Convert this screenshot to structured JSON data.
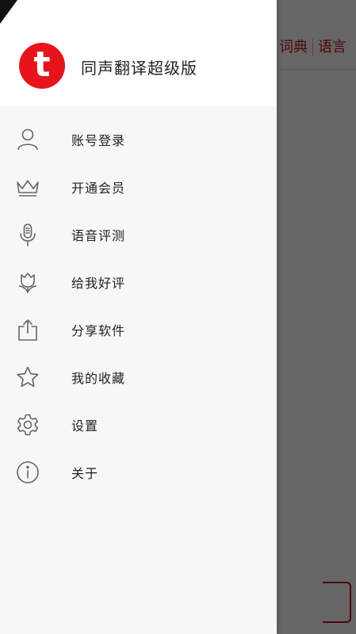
{
  "app": {
    "title": "同声翻译超级版",
    "logo_letter": "t",
    "brand_color": "#e8141c"
  },
  "background": {
    "tabs": [
      "词典",
      "语言"
    ]
  },
  "menu": {
    "items": [
      {
        "label": "账号登录",
        "icon": "user-icon"
      },
      {
        "label": "开通会员",
        "icon": "crown-icon"
      },
      {
        "label": "语音评测",
        "icon": "microphone-icon"
      },
      {
        "label": "给我好评",
        "icon": "flower-icon"
      },
      {
        "label": "分享软件",
        "icon": "share-icon"
      },
      {
        "label": "我的收藏",
        "icon": "star-icon"
      },
      {
        "label": "设置",
        "icon": "gear-icon"
      },
      {
        "label": "关于",
        "icon": "info-icon"
      }
    ]
  }
}
